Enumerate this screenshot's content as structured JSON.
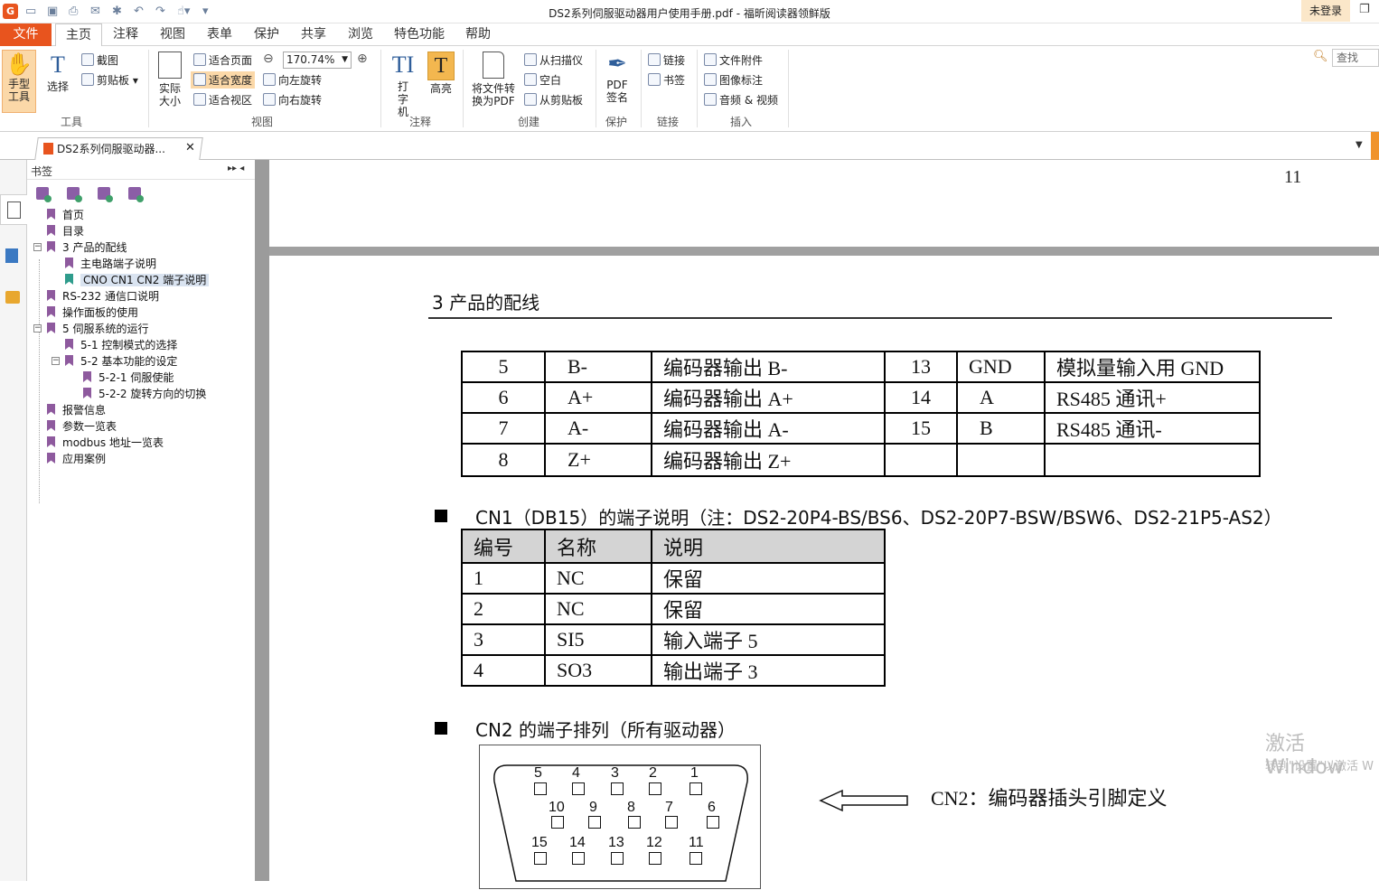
{
  "titlebar": {
    "title": "DS2系列伺服驱动器用户使用手册.pdf - 福昕阅读器领鲜版",
    "login": "未登录"
  },
  "menu": [
    "文件",
    "主页",
    "注释",
    "视图",
    "表单",
    "保护",
    "共享",
    "浏览",
    "特色功能",
    "帮助"
  ],
  "ribbon": {
    "hand_tool": "手型工具",
    "select": "选择",
    "screenshot": "截图",
    "clipboard": "剪贴板",
    "tools_group": "工具",
    "actual_size": "实际大小",
    "fit_page": "适合页面",
    "fit_width": "适合宽度",
    "fit_visible": "适合视区",
    "zoom": "170.74%",
    "rotate_left": "向左旋转",
    "rotate_right": "向右旋转",
    "view_group": "视图",
    "typewriter": "打字机",
    "highlight": "高亮",
    "comment_group": "注释",
    "convert_pdf": "将文件转换为PDF",
    "from_scanner": "从扫描仪",
    "blank": "空白",
    "from_clipboard": "从剪贴板",
    "create_group": "创建",
    "pdf_sign": "PDF签名",
    "protect_group": "保护",
    "link": "链接",
    "bookmark": "书签",
    "link_group": "链接",
    "file_attach": "文件附件",
    "image_annot": "图像标注",
    "audio_video": "音频 & 视频",
    "insert_group": "插入",
    "search": "查找"
  },
  "tab": {
    "doc_name": "DS2系列伺服驱动器..."
  },
  "sidebar": {
    "title": "书签",
    "items": [
      {
        "label": "首页"
      },
      {
        "label": "目录"
      },
      {
        "label": "3 产品的配线"
      },
      {
        "label": "主电路端子说明"
      },
      {
        "label": "CNO CN1  CN2 端子说明"
      },
      {
        "label": "RS-232 通信口说明"
      },
      {
        "label": "操作面板的使用"
      },
      {
        "label": "5 伺服系统的运行"
      },
      {
        "label": "5-1  控制模式的选择"
      },
      {
        "label": "5-2 基本功能的设定"
      },
      {
        "label": "5-2-1 伺服使能"
      },
      {
        "label": "5-2-2  旋转方向的切换"
      },
      {
        "label": "报警信息"
      },
      {
        "label": "参数一览表"
      },
      {
        "label": "modbus 地址一览表"
      },
      {
        "label": "应用案例"
      }
    ]
  },
  "doc": {
    "page_num": "11",
    "section_title": "3  产品的配线",
    "tbl1": [
      [
        "5",
        "B-",
        "编码器输出 B-",
        "13",
        "GND",
        "模拟量输入用 GND"
      ],
      [
        "6",
        "A+",
        "编码器输出 A+",
        "14",
        "A",
        "RS485 通讯+"
      ],
      [
        "7",
        "A-",
        "编码器输出 A-",
        "15",
        "B",
        "RS485 通讯-"
      ],
      [
        "8",
        "Z+",
        "编码器输出 Z+",
        "",
        "",
        ""
      ]
    ],
    "cn1_heading": "CN1（DB15）的端子说明（注：DS2-20P4-BS/BS6、DS2-20P7-BSW/BSW6、DS2-21P5-AS2）",
    "tbl2_head": [
      "编号",
      "名称",
      "说明"
    ],
    "tbl2": [
      [
        "1",
        "NC",
        "保留"
      ],
      [
        "2",
        "NC",
        "保留"
      ],
      [
        "3",
        "SI5",
        "输入端子 5"
      ],
      [
        "4",
        "SO3",
        "输出端子 3"
      ]
    ],
    "cn2_heading": "CN2 的端子排列（所有驱动器）",
    "cn2_def": "CN2：编码器插头引脚定义",
    "pins_row1": [
      "5",
      "4",
      "3",
      "2",
      "1"
    ],
    "pins_row2": [
      "10",
      "9",
      "8",
      "7",
      "6"
    ],
    "pins_row3": [
      "15",
      "14",
      "13",
      "12",
      "11"
    ]
  },
  "watermark": {
    "line1": "激活 Window",
    "line2": "转到\"设置\"以激活 W"
  }
}
